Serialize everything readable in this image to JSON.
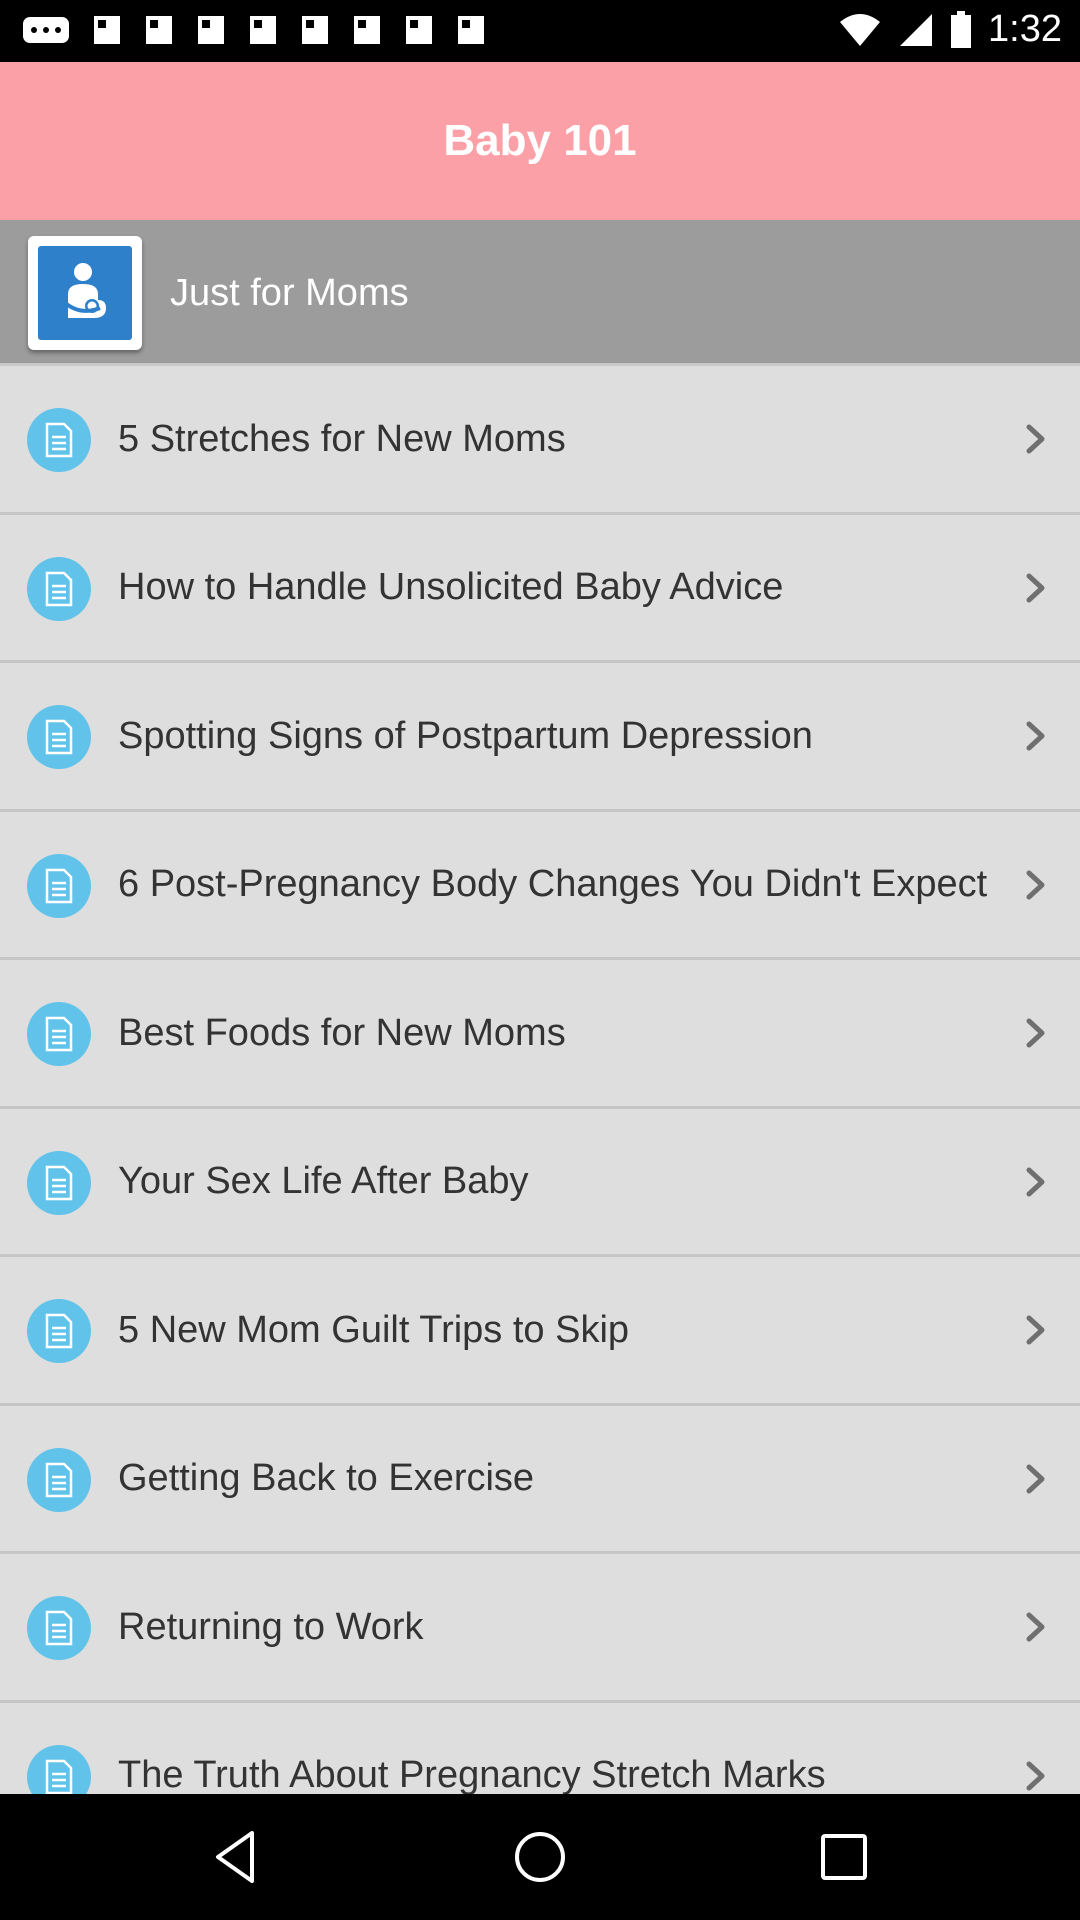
{
  "status_bar": {
    "time": "1:32",
    "left_icons": [
      "notification-icon",
      "image-icon",
      "image-icon",
      "image-icon",
      "image-icon",
      "image-icon",
      "image-icon",
      "image-icon",
      "image-icon"
    ],
    "right_icons": [
      "wifi-icon",
      "signal-icon",
      "battery-icon"
    ]
  },
  "header": {
    "title": "Baby 101"
  },
  "section": {
    "title": "Just for Moms",
    "icon": "mother-baby-icon"
  },
  "list": {
    "items": [
      {
        "label": "5 Stretches for New Moms"
      },
      {
        "label": "How to Handle Unsolicited Baby Advice"
      },
      {
        "label": "Spotting Signs of Postpartum Depression"
      },
      {
        "label": "6 Post-Pregnancy Body Changes You Didn't Expect"
      },
      {
        "label": "Best Foods for New Moms"
      },
      {
        "label": "Your Sex Life After Baby"
      },
      {
        "label": "5 New Mom Guilt Trips to Skip"
      },
      {
        "label": "Getting Back to Exercise"
      },
      {
        "label": "Returning to Work"
      },
      {
        "label": "The Truth About Pregnancy Stretch Marks"
      }
    ],
    "item_icon": "document-icon",
    "chevron_icon": "chevron-right-icon"
  },
  "nav_bar": {
    "buttons": [
      "back-button",
      "home-button",
      "recents-button"
    ]
  },
  "colors": {
    "header_bg": "#fca0a8",
    "section_bg": "#9c9c9c",
    "list_bg": "#dedede",
    "item_icon_bg": "#62c3ea",
    "section_icon_bg": "#2f80cb"
  }
}
